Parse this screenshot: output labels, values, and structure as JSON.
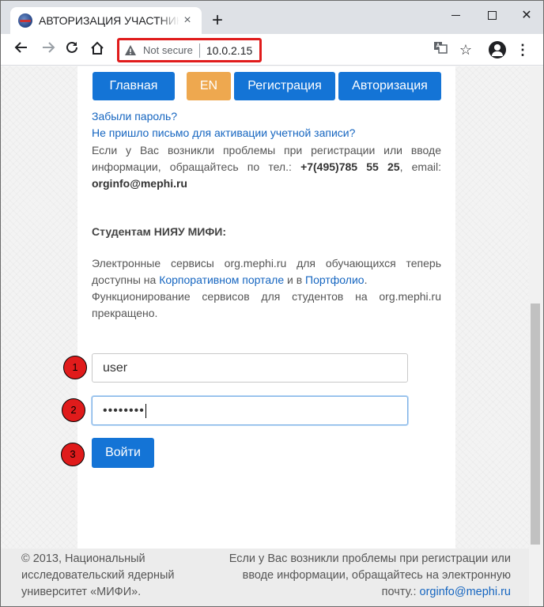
{
  "browser": {
    "tab_title": "АВТОРИЗАЦИЯ УЧАСТНИКА",
    "tab_close": "×",
    "new_tab": "+",
    "security_label": "Not secure",
    "url": "10.0.2.15"
  },
  "nav": {
    "main": "Главная",
    "lang": "EN",
    "register": "Регистрация",
    "auth": "Авторизация"
  },
  "links": {
    "forgot_password": "Забыли пароль?",
    "no_activation_email": "Не пришло письмо для активации учетной записи?"
  },
  "info": {
    "text_before": "Если у Вас возникли проблемы при регистрации или вводе информации, обращайтесь по тел.: ",
    "phone": "+7(495)785 55 25",
    "text_mid": ", email: ",
    "email": "orginfo@mephi.ru"
  },
  "students": {
    "title": "Студентам НИЯУ МИФИ:",
    "p1_before": "Электронные сервисы org.mephi.ru для обучающихся теперь доступны на ",
    "portal_link": "Корпоративном портале",
    "p1_mid": " и в ",
    "portfolio_link": "Портфолио",
    "p1_end": ".",
    "p2": "Функционирование сервисов для студентов на org.mephi.ru прекращено."
  },
  "form": {
    "username_value": "user",
    "password_value": "••••••••",
    "submit_label": "Войти"
  },
  "markers": [
    "1",
    "2",
    "3"
  ],
  "footer": {
    "left": "© 2013, Национальный исследовательский ядерный университет «МИФИ».",
    "right_text": "Если у Вас возникли проблемы при регистрации или вводе информации, обращайтесь на электронную почту.: ",
    "right_email": "orginfo@mephi.ru"
  },
  "colors": {
    "primary": "#1474d6",
    "lang_button": "#eea84f",
    "highlight": "#e01b1b"
  }
}
